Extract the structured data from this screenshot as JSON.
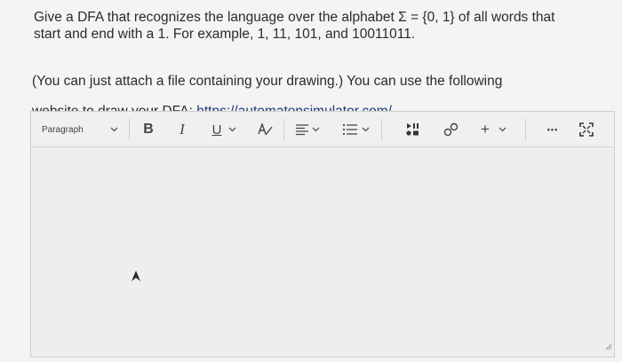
{
  "question": {
    "line1": "Give a DFA that recognizes the language over the alphabet Σ = {0, 1} of all words that",
    "line2": "start and end with a 1. For example, 1, 11, 101, and 10011011.",
    "line3": "(You can just attach a file containing your drawing.) You can use the following",
    "line4_prefix": "website to draw your DFA: ",
    "link": "https://automatonsimulator.com/"
  },
  "toolbar": {
    "paragraph_label": "Paragraph",
    "bold_label": "B",
    "italic_label": "I",
    "underline_label": "U",
    "insert_label": "+",
    "more_label": "•••"
  },
  "colors": {
    "link": "#1e3a78",
    "text": "#2b2b2b"
  }
}
